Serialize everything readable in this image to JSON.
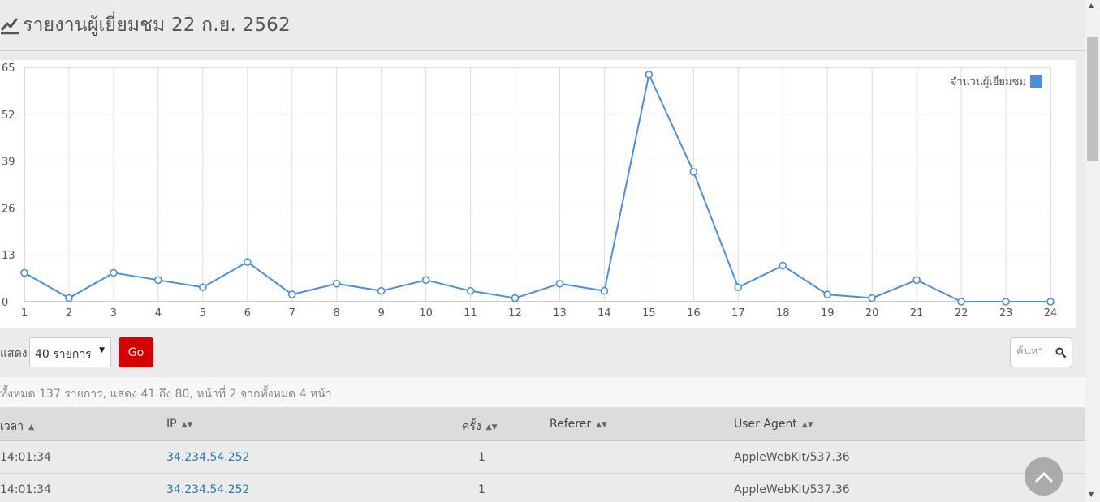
{
  "header": {
    "icon": "line-chart-icon",
    "title": "รายงานผู้เยี่ยมชม 22 ก.ย. 2562"
  },
  "chart_data": {
    "type": "line",
    "x": [
      "1",
      "2",
      "3",
      "4",
      "5",
      "6",
      "7",
      "8",
      "9",
      "10",
      "11",
      "12",
      "13",
      "14",
      "15",
      "16",
      "17",
      "18",
      "19",
      "20",
      "21",
      "22",
      "23",
      "24"
    ],
    "series": [
      {
        "name": "จำนวนผู้เยี่ยมชม",
        "color": "#4a8fdf",
        "values": [
          8,
          1,
          8,
          6,
          4,
          11,
          2,
          5,
          3,
          6,
          3,
          1,
          5,
          3,
          63,
          36,
          4,
          10,
          2,
          1,
          6,
          0,
          0,
          0
        ]
      }
    ],
    "y_ticks": [
      "0",
      "13",
      "26",
      "39",
      "52",
      "65"
    ],
    "ylim": [
      0,
      65
    ],
    "grid": true,
    "legend_position": "top-right"
  },
  "controls": {
    "show_label": "แสดง",
    "page_size_value": "40 รายการ",
    "go_label": "Go",
    "search_placeholder": "ค้นหา"
  },
  "summary": "ทั้งหมด 137 รายการ, แสดง 41 ถึง 80, หน้าที่ 2 จากทั้งหมด 4 หน้า",
  "table": {
    "columns": [
      "เวลา",
      "IP",
      "ครั้ง",
      "Referer",
      "User Agent"
    ],
    "rows": [
      {
        "time": "14:01:34",
        "ip": "34.234.54.252",
        "count": "1",
        "referer": "",
        "agent": "AppleWebKit/537.36"
      },
      {
        "time": "14:01:34",
        "ip": "34.234.54.252",
        "count": "1",
        "referer": "",
        "agent": "AppleWebKit/537.36"
      }
    ]
  },
  "colors": {
    "accent": "#d70000",
    "link": "#2a7ab0",
    "series": "#4a8fdf"
  }
}
